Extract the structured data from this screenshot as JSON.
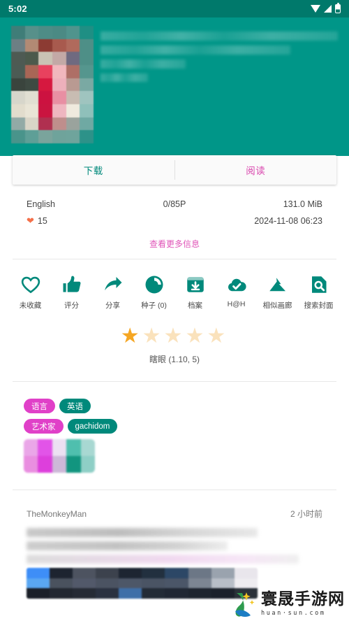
{
  "statusbar": {
    "time": "5:02",
    "icons": [
      "wifi-icon",
      "signal-icon",
      "battery-icon"
    ]
  },
  "header": {
    "cover_censored": true,
    "title_censored": true,
    "background_color": "#009688"
  },
  "action_card": {
    "download_label": "下载",
    "download_color": "#00897B",
    "read_label": "阅读",
    "read_color": "#D946AE"
  },
  "info": {
    "language": "English",
    "pages": "0/85P",
    "size": "131.0 MiB",
    "favorites_icon": "heart-icon",
    "favorites_count": "15",
    "posted": "2024-11-08 06:23",
    "more_link": "查看更多信息",
    "more_link_color": "#E055B8"
  },
  "actions": [
    {
      "icon": "heart-outline-icon",
      "label": "未收藏"
    },
    {
      "icon": "thumbs-up-icon",
      "label": "评分"
    },
    {
      "icon": "share-arrow-icon",
      "label": "分享"
    },
    {
      "icon": "torrent-icon",
      "label": "种子 (0)"
    },
    {
      "icon": "archive-download-icon",
      "label": "档案"
    },
    {
      "icon": "cloud-check-icon",
      "label": "H@H"
    },
    {
      "icon": "image-mountain-icon",
      "label": "相似画廊"
    },
    {
      "icon": "search-document-icon",
      "label": "搜索封面"
    }
  ],
  "rating": {
    "filled": 1,
    "total": 5,
    "star_on_color": "#F5A623",
    "star_off_color": "#FAE2BC",
    "text": "瞎眼 (1.10, 5)"
  },
  "tags": {
    "rows": [
      {
        "key": "语言",
        "value": "英语",
        "censored": false
      },
      {
        "key": "艺术家",
        "value": "gachidom",
        "censored": false
      },
      {
        "key": "",
        "value": "",
        "censored": true
      }
    ],
    "key_color": "#E040C8",
    "value_color": "#00897B"
  },
  "comment": {
    "username": "TheMonkeyMan",
    "time": "2 小时前",
    "body_censored": true
  },
  "watermark": {
    "title": "寰晟手游网",
    "domain": "huan·sun.com"
  }
}
